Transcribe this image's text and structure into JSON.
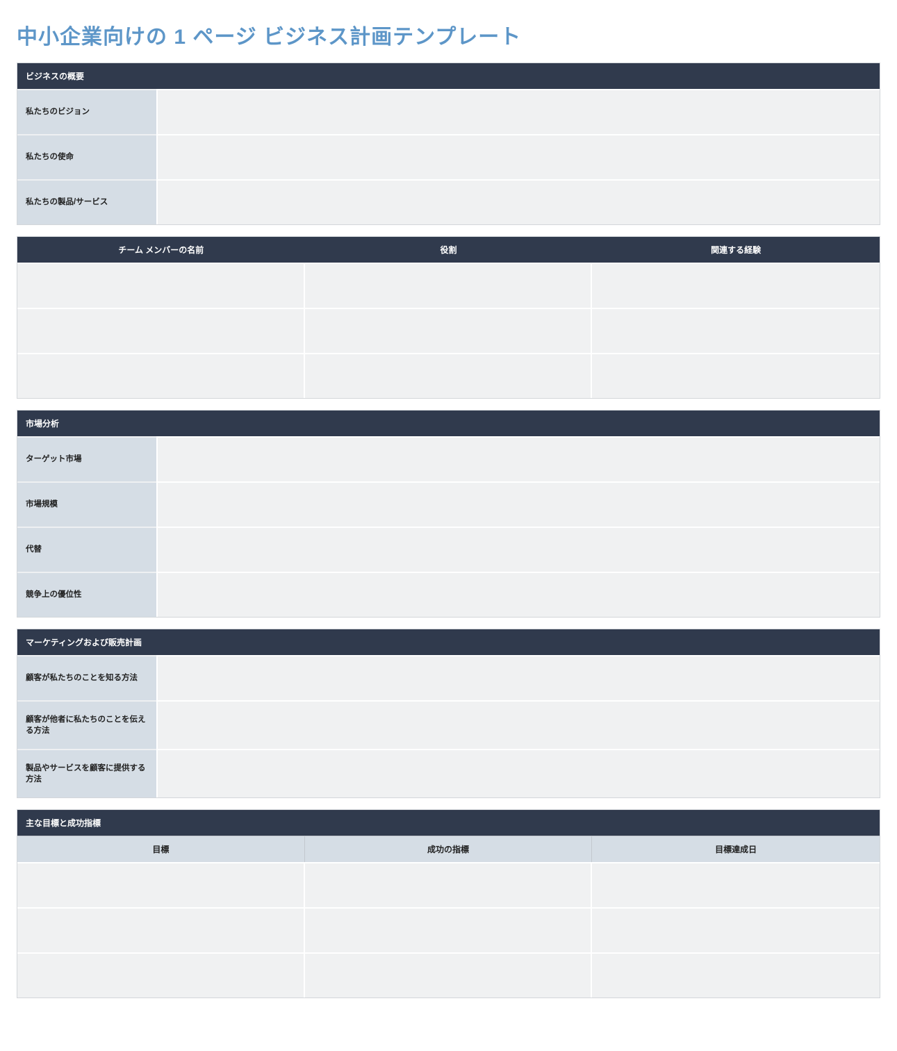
{
  "title": "中小企業向けの 1 ページ ビジネス計画テンプレート",
  "overview": {
    "header": "ビジネスの概要",
    "rows": [
      {
        "label": "私たちのビジョン",
        "value": ""
      },
      {
        "label": "私たちの使命",
        "value": ""
      },
      {
        "label": "私たちの製品/サービス",
        "value": ""
      }
    ]
  },
  "team": {
    "columns": [
      "チーム メンバーの名前",
      "役割",
      "関連する経験"
    ],
    "rows": [
      [
        "",
        "",
        ""
      ],
      [
        "",
        "",
        ""
      ],
      [
        "",
        "",
        ""
      ]
    ]
  },
  "market": {
    "header": "市場分析",
    "rows": [
      {
        "label": "ターゲット市場",
        "value": ""
      },
      {
        "label": "市場規模",
        "value": ""
      },
      {
        "label": "代替",
        "value": ""
      },
      {
        "label": "競争上の優位性",
        "value": ""
      }
    ]
  },
  "marketing": {
    "header": "マーケティングおよび販売計画",
    "rows": [
      {
        "label": "顧客が私たちのことを知る方法",
        "value": ""
      },
      {
        "label": "顧客が他者に私たちのことを伝える方法",
        "value": ""
      },
      {
        "label": "製品やサービスを顧客に提供する方法",
        "value": ""
      }
    ]
  },
  "goals": {
    "header": "主な目標と成功指標",
    "columns": [
      "目標",
      "成功の指標",
      "目標達成日"
    ],
    "rows": [
      [
        "",
        "",
        ""
      ],
      [
        "",
        "",
        ""
      ],
      [
        "",
        "",
        ""
      ]
    ]
  }
}
